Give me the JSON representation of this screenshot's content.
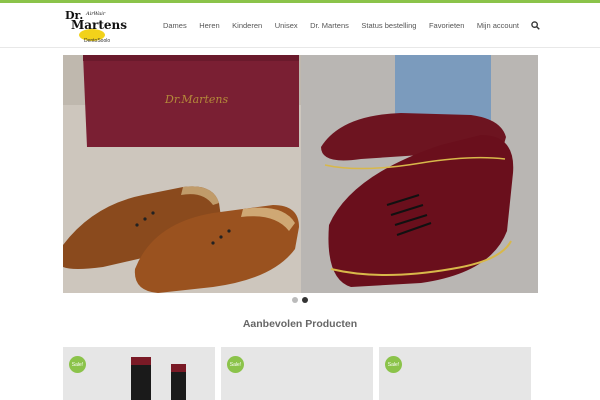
{
  "brand": {
    "logo_line1": "Dr.",
    "logo_line2": "AirWair",
    "logo_line3": "Martens",
    "logo_sub": "DentoSoolo"
  },
  "nav": {
    "items": [
      "Dames",
      "Heren",
      "Kinderen",
      "Unisex",
      "Dr. Martens",
      "Status bestelling",
      "Favorieten",
      "Mijn account"
    ],
    "search_icon": "search-icon"
  },
  "slider": {
    "dots": 2,
    "active_dot": 2
  },
  "section": {
    "title": "Aanbevolen Producten"
  },
  "products": [
    {
      "badge": "Sale!"
    },
    {
      "badge": "Sale!"
    },
    {
      "badge": "Sale!"
    }
  ],
  "colors": {
    "accent": "#8bc34a",
    "nav_text": "#555555",
    "card_bg": "#e6e6e6"
  }
}
